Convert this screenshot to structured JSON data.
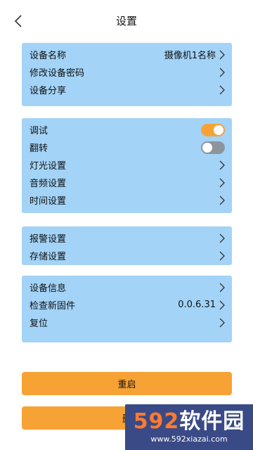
{
  "header": {
    "title": "设置",
    "back_icon": "chevron-left-icon"
  },
  "groups": {
    "device": {
      "items": [
        {
          "label": "设备名称",
          "value": "摄像机1名称"
        },
        {
          "label": "修改设备密码"
        },
        {
          "label": "设备分享"
        }
      ]
    },
    "camera": {
      "items": [
        {
          "label": "调试",
          "toggle": "on"
        },
        {
          "label": "翻转",
          "toggle": "off"
        },
        {
          "label": "灯光设置"
        },
        {
          "label": "音频设置"
        },
        {
          "label": "时间设置"
        }
      ]
    },
    "alarm": {
      "items": [
        {
          "label": "报警设置"
        },
        {
          "label": "存储设置"
        }
      ]
    },
    "system": {
      "items": [
        {
          "label": "设备信息"
        },
        {
          "label": "检查新固件",
          "value": "0.0.6.31"
        },
        {
          "label": "复位"
        }
      ]
    }
  },
  "buttons": {
    "restart_label": "重启",
    "delete_label": "删"
  },
  "watermark": {
    "logo_num": "592",
    "logo_text": "软件园",
    "url": "www.592xiazai.com"
  },
  "colors": {
    "panel": "#a3d3f7",
    "accent": "#f7a234",
    "toggle_off": "#8d959c"
  }
}
